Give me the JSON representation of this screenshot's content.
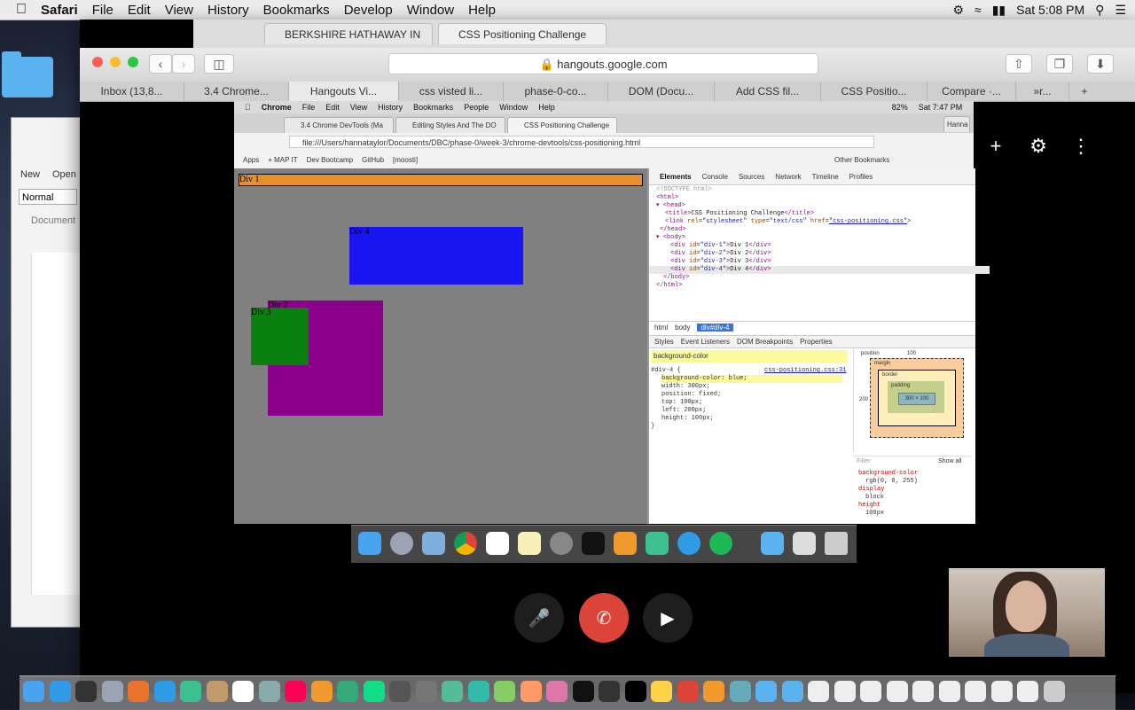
{
  "menubar": {
    "app": "Safari",
    "items": [
      "File",
      "Edit",
      "View",
      "History",
      "Bookmarks",
      "Develop",
      "Window",
      "Help"
    ],
    "clock": "Sat 5:08 PM"
  },
  "writer": {
    "new": "New",
    "open": "Open",
    "style": "Normal",
    "document": "Document"
  },
  "safari": {
    "top_tabs": [
      "BERKSHIRE HATHAWAY IN",
      "CSS Positioning Challenge"
    ],
    "address": "hangouts.google.com",
    "tabs": [
      "Inbox (13,8...",
      "3.4 Chrome...",
      "Hangouts Vi...",
      "css visted li...",
      "phase-0-co...",
      "DOM (Docu...",
      "Add CSS fil...",
      "CSS Positio...",
      "Compare ·...",
      "»r..."
    ],
    "active_tab_index": 2
  },
  "shared_screen": {
    "menubar": [
      "Chrome",
      "File",
      "Edit",
      "View",
      "History",
      "Bookmarks",
      "People",
      "Window",
      "Help"
    ],
    "battery": "82%",
    "time": "Sat 7:47 PM",
    "user": "Hanna",
    "tabs": [
      "3.4 Chrome DevTools (Ma",
      "Editing Styles And The DO",
      "CSS Positioning Challenge"
    ],
    "url": "file:///Users/hannataylor/Documents/DBC/phase-0/week-3/chrome-devtools/css-positioning.html",
    "bookmarks": [
      "Apps",
      "+ MAP IT",
      "Dev Bootcamp",
      "GitHub",
      "[moosti]"
    ],
    "other_bookmarks": "Other Bookmarks",
    "divs": {
      "div1": "Div 1",
      "div2": "Div 2",
      "div3": "Div 3",
      "div4": "Div 4"
    },
    "div_colors": {
      "div1": "#e8902c",
      "div2": "#8b008b",
      "div3": "#0a800f",
      "div4": "#1a14f0"
    },
    "devtools": {
      "tabs": [
        "Elements",
        "Console",
        "Sources",
        "Network",
        "Timeline",
        "Profiles"
      ],
      "breadcrumb": [
        "html",
        "body",
        "div#div-4"
      ],
      "sub_tabs": [
        "Styles",
        "Event Listeners",
        "DOM Breakpoints",
        "Properties"
      ],
      "filter_value": "background-color",
      "rule_selector": "#div-4 {",
      "rule_source": "css-positioning.css:31",
      "rule_lines": [
        "background-color: blue;",
        "width: 300px;",
        "position: fixed;",
        "top: 100px;",
        "left: 200px;",
        "height: 100px;"
      ],
      "box_position": "position",
      "box_top": "100",
      "box_left": "200",
      "box_margin": "margin",
      "box_border": "border",
      "box_padding": "padding",
      "box_size": "300 × 100",
      "filter_label": "Filter",
      "show_all": "Show all",
      "computed": [
        "background-color",
        "rgb(0, 0, 255)",
        "display",
        "block",
        "height",
        "100px"
      ]
    }
  }
}
